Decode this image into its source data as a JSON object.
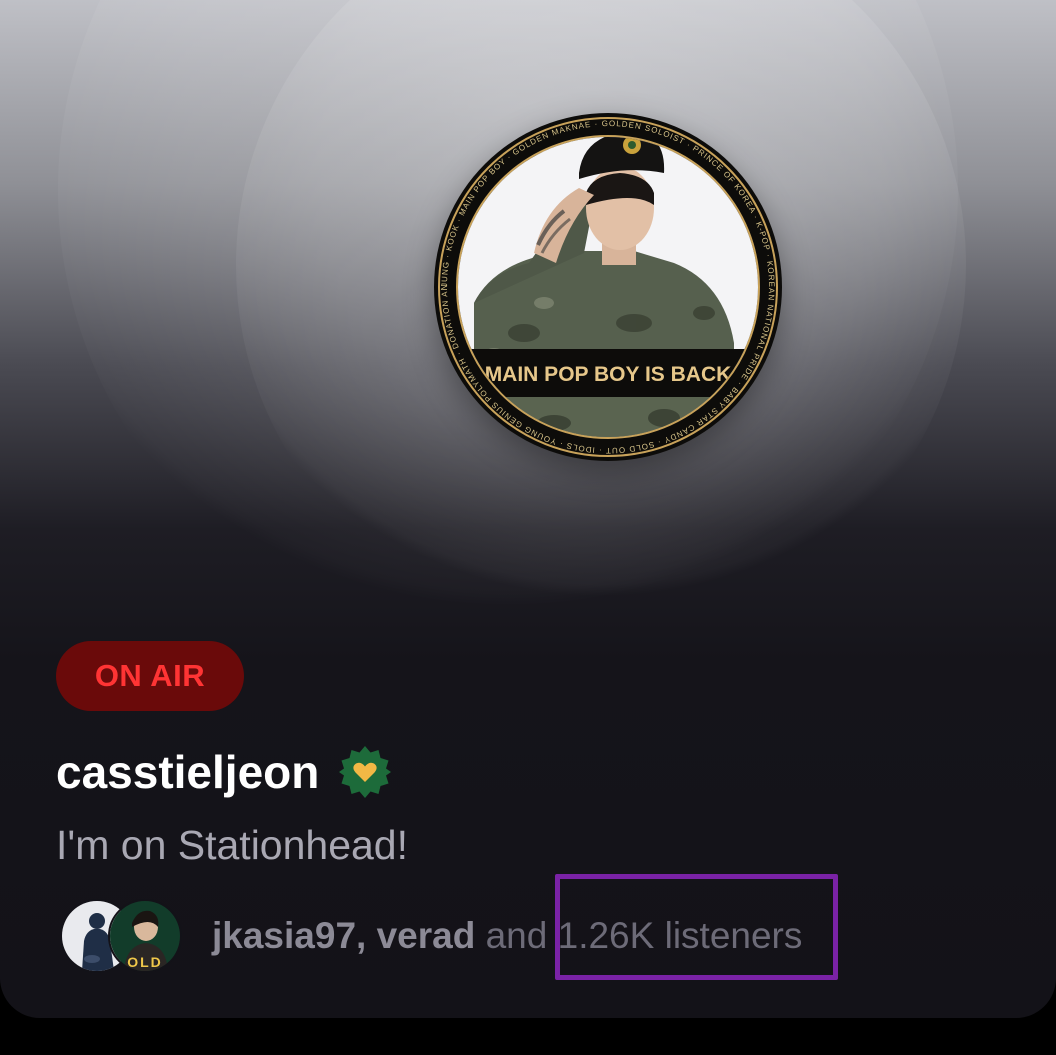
{
  "station": {
    "status_badge": "ON AIR",
    "username": "casstieljeon",
    "verified_icon": "verified-heart-badge-icon",
    "subtitle": "I'm on Stationhead!",
    "avatar": {
      "banner_text": "MAIN POP BOY IS BACK",
      "ring_text": "JUNG · KOOK · MAIN POP BOY · GOLDEN MAKNAE · GOLDEN SOLOIST · PRINCE OF KOREA · K-POP · KOREAN NATIONAL PRIDE · BABY STAR CANDY · SOLD OUT · IDOLS · YOUNG GENIUS POLYMATH · DONATION ANGEL · GIANT GLOBAL POP STAR · "
    },
    "listeners": {
      "names": "jkasia97, verad",
      "connector": "and",
      "count": "1.26K listeners",
      "second_avatar_text": "OLD"
    }
  },
  "colors": {
    "on_air_bg": "#6a0a0a",
    "on_air_text": "#ff3434",
    "verified_badge": "#1d6b3a",
    "badge_heart": "#f2b845",
    "highlight_box": "#7a22a6"
  }
}
